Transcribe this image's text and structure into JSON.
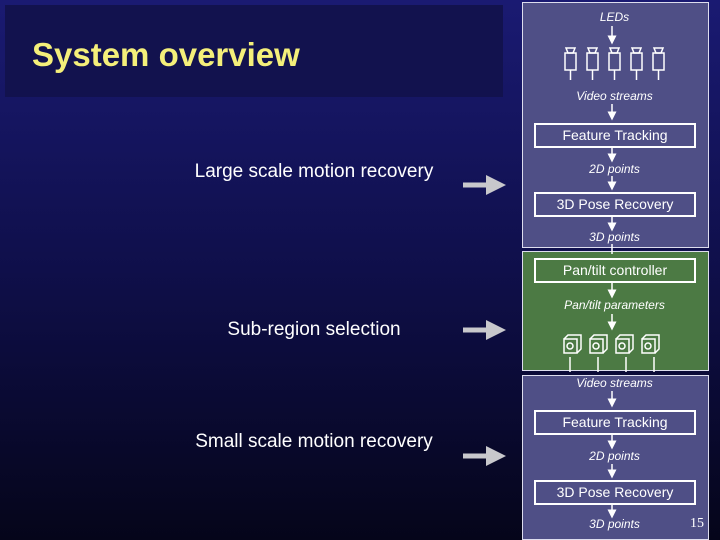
{
  "title": "System overview",
  "stages": [
    {
      "label": "Large scale motion recovery"
    },
    {
      "label": "Sub-region selection"
    },
    {
      "label": "Small scale motion recovery"
    }
  ],
  "diagram": {
    "leds": "LEDs",
    "video_streams": "Video streams",
    "feature_tracking": "Feature Tracking",
    "points_2d": "2D points",
    "pose_recovery": "3D Pose Recovery",
    "points_3d": "3D points",
    "pantilt_controller": "Pan/tilt controller",
    "pantilt_params": "Pan/tilt parameters"
  },
  "colors": {
    "title": "#f4ef7a",
    "blue_panel": "#4f4f86",
    "green_panel": "#4c7a44"
  },
  "page_number": "15"
}
